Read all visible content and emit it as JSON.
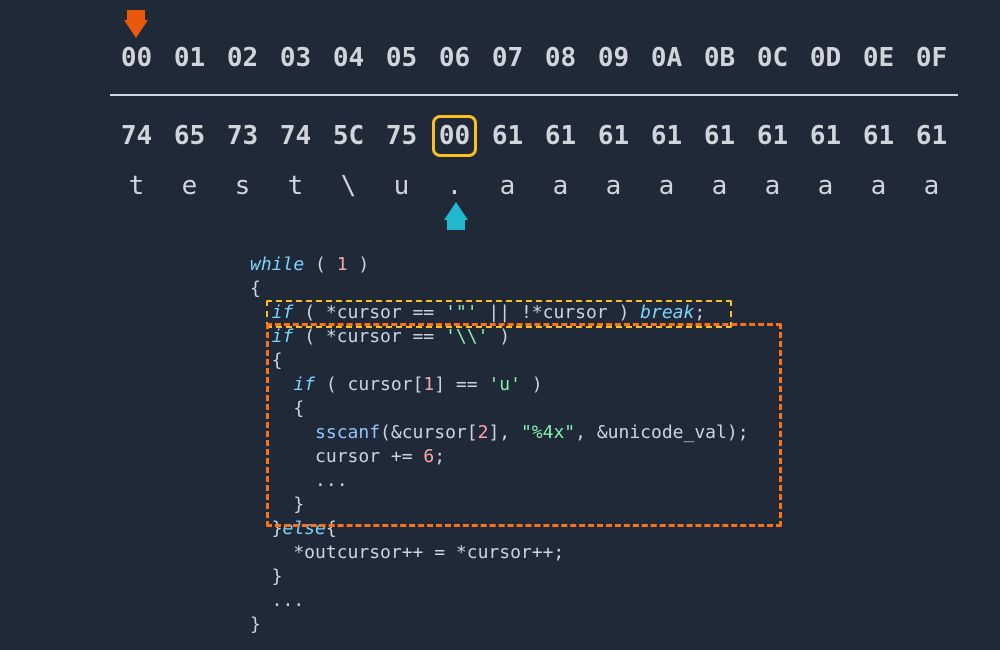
{
  "hex": {
    "offsets": [
      "00",
      "01",
      "02",
      "03",
      "04",
      "05",
      "06",
      "07",
      "08",
      "09",
      "0A",
      "0B",
      "0C",
      "0D",
      "0E",
      "0F"
    ],
    "bytes": [
      "74",
      "65",
      "73",
      "74",
      "5C",
      "75",
      "00",
      "61",
      "61",
      "61",
      "61",
      "61",
      "61",
      "61",
      "61",
      "61"
    ],
    "ascii": [
      "t",
      "e",
      "s",
      "t",
      "\\",
      "u",
      ".",
      "a",
      "a",
      "a",
      "a",
      "a",
      "a",
      "a",
      "a",
      "a"
    ],
    "highlight_index": 6,
    "pointer_top_index": 0,
    "pointer_bottom_index": 6
  },
  "code": {
    "l0a": "while",
    "l0b": " ( ",
    "l0c": "1",
    "l0d": " )",
    "l1": "{",
    "l2a": "  if",
    "l2b": " ( *cursor == ",
    "l2c": "'\"'",
    "l2d": " || !*cursor ) ",
    "l2e": "break",
    "l2f": ";",
    "l3a": "  if",
    "l3b": " ( *cursor == ",
    "l3c": "'\\\\'",
    "l3d": " )",
    "l4": "  {",
    "l5a": "    if",
    "l5b": " ( cursor[",
    "l5c": "1",
    "l5d": "] == ",
    "l5e": "'u'",
    "l5f": " )",
    "l6": "    {",
    "l7a": "      sscanf",
    "l7b": "(&cursor[",
    "l7c": "2",
    "l7d": "], ",
    "l7e": "\"%4x\"",
    "l7f": ", &unicode_val);",
    "l8a": "      cursor += ",
    "l8b": "6",
    "l8c": ";",
    "l9": "      ...",
    "l10": "    }",
    "l11a": "  }",
    "l11b": "else",
    "l11c": "{",
    "l12": "    *outcursor++ = *cursor++;",
    "l13": "  }",
    "l14": "  ...",
    "l15": "}"
  }
}
